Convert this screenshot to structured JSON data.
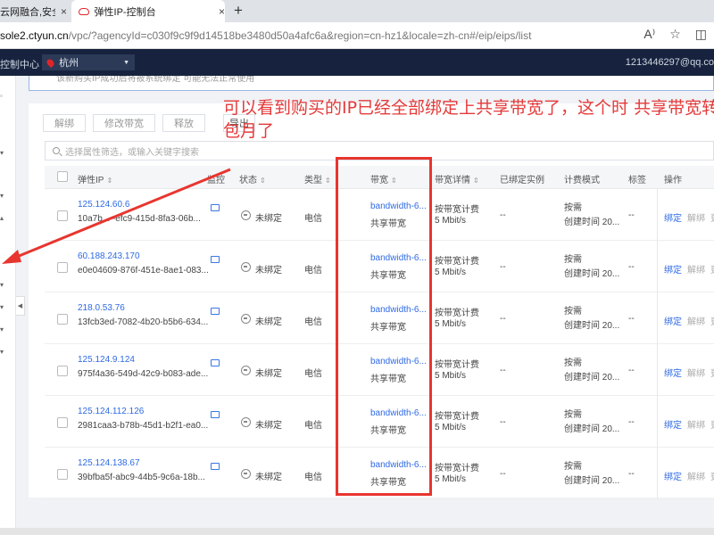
{
  "browser": {
    "tabs": [
      {
        "label": "云网融合,安全可",
        "close": "×"
      },
      {
        "label": "弹性IP-控制台",
        "close": "×"
      }
    ],
    "new_tab": "+",
    "url_host": "sole2.ctyun.cn",
    "url_path": "/vpc/?agencyId=c030f9c9f9d14518be3480d50a4afc6a&region=cn-hz1&locale=zh-cn#/eip/eips/list",
    "icons": [
      "read-aloud-icon",
      "favorite-star-icon",
      "split-screen-icon"
    ]
  },
  "console": {
    "link": "控制中心",
    "region": "杭州",
    "account": "1213446297@qq.co"
  },
  "notice": "该新购买IP成功后将被系统绑定 可能无法正常使用",
  "toolbar": {
    "unbind": "解绑",
    "modify_bandwidth": "修改带宽",
    "release": "释放",
    "export": "导出"
  },
  "search": {
    "placeholder": "选择属性筛选，或输入关键字搜索"
  },
  "table": {
    "headers": {
      "ip": "弹性IP",
      "monitor": "监控",
      "status": "状态",
      "type": "类型",
      "bandwidth": "带宽",
      "bandwidth_detail": "带宽详情",
      "bound": "已绑定实例",
      "billing": "计费模式",
      "tag": "标签",
      "ops": "操作"
    },
    "rows": [
      {
        "ip": "125.124.60.6",
        "uuid": "10a7b... -efc9-415d-8fa3-06b...",
        "status": "未绑定",
        "type": "电信",
        "bw_name": "bandwidth-6...",
        "bw_type": "共享带宽",
        "bw_det1": "按带宽计费",
        "bw_det2": "5 Mbit/s",
        "bound": "--",
        "bill1": "按需",
        "bill2": "创建时间 20...",
        "tag": "--",
        "op_bind": "绑定",
        "op_unbind": "解绑",
        "op_more": "更"
      },
      {
        "ip": "60.188.243.170",
        "uuid": "e0e04609-876f-451e-8ae1-083...",
        "status": "未绑定",
        "type": "电信",
        "bw_name": "bandwidth-6...",
        "bw_type": "共享带宽",
        "bw_det1": "按带宽计费",
        "bw_det2": "5 Mbit/s",
        "bound": "--",
        "bill1": "按需",
        "bill2": "创建时间 20...",
        "tag": "--",
        "op_bind": "绑定",
        "op_unbind": "解绑",
        "op_more": "更"
      },
      {
        "ip": "218.0.53.76",
        "uuid": "13fcb3ed-7082-4b20-b5b6-634...",
        "status": "未绑定",
        "type": "电信",
        "bw_name": "bandwidth-6...",
        "bw_type": "共享带宽",
        "bw_det1": "按带宽计费",
        "bw_det2": "5 Mbit/s",
        "bound": "--",
        "bill1": "按需",
        "bill2": "创建时间 20...",
        "tag": "--",
        "op_bind": "绑定",
        "op_unbind": "解绑",
        "op_more": "更"
      },
      {
        "ip": "125.124.9.124",
        "uuid": "975f4a36-549d-42c9-b083-ade...",
        "status": "未绑定",
        "type": "电信",
        "bw_name": "bandwidth-6...",
        "bw_type": "共享带宽",
        "bw_det1": "按带宽计费",
        "bw_det2": "5 Mbit/s",
        "bound": "--",
        "bill1": "按需",
        "bill2": "创建时间 20...",
        "tag": "--",
        "op_bind": "绑定",
        "op_unbind": "解绑",
        "op_more": "更"
      },
      {
        "ip": "125.124.112.126",
        "uuid": "2981caa3-b78b-45d1-b2f1-ea0...",
        "status": "未绑定",
        "type": "电信",
        "bw_name": "bandwidth-6...",
        "bw_type": "共享带宽",
        "bw_det1": "按带宽计费",
        "bw_det2": "5 Mbit/s",
        "bound": "--",
        "bill1": "按需",
        "bill2": "创建时间 20...",
        "tag": "--",
        "op_bind": "绑定",
        "op_unbind": "解绑",
        "op_more": "更"
      },
      {
        "ip": "125.124.138.67",
        "uuid": "39bfba5f-abc9-44b5-9c6a-18b...",
        "status": "未绑定",
        "type": "电信",
        "bw_name": "bandwidth-6...",
        "bw_type": "共享带宽",
        "bw_det1": "按带宽计费",
        "bw_det2": "5 Mbit/s",
        "bound": "--",
        "bill1": "按需",
        "bill2": "创建时间 20...",
        "tag": "--",
        "op_bind": "绑定",
        "op_unbind": "解绑",
        "op_more": "更"
      }
    ]
  },
  "annotation": {
    "text": "可以看到购买的IP已经全部绑定上共享带宽了，这个时 共享带宽转包月了",
    "color": "#e53a3a"
  }
}
